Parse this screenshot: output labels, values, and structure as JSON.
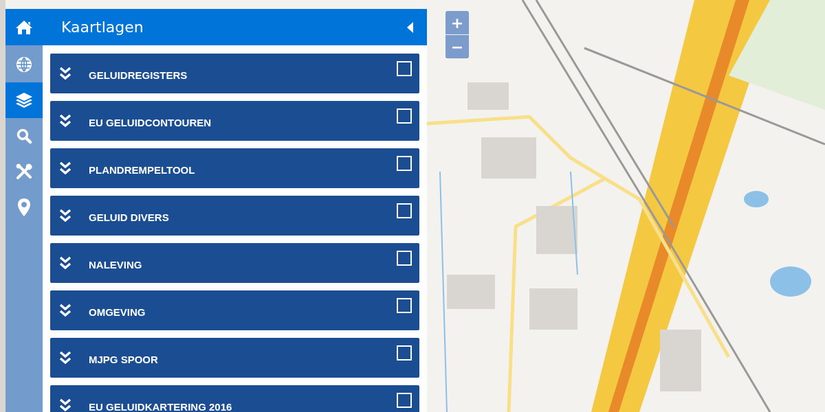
{
  "zoom_controls": [
    "+",
    "−"
  ],
  "panel": {
    "title": "Kaartlagen",
    "nav_items": [
      {
        "kind": "globe",
        "selected": false
      },
      {
        "kind": "layers",
        "selected": true
      },
      {
        "kind": "search",
        "selected": false
      },
      {
        "kind": "tools",
        "selected": false
      },
      {
        "kind": "pin",
        "selected": false
      }
    ],
    "layers": [
      {
        "label": "GELUIDREGISTERS",
        "checked": false,
        "expanded": false
      },
      {
        "label": "EU GELUIDCONTOUREN",
        "checked": false,
        "expanded": false
      },
      {
        "label": "PLANDREMPELTOOL",
        "checked": false,
        "expanded": false
      },
      {
        "label": "GELUID DIVERS",
        "checked": false,
        "expanded": false
      },
      {
        "label": "NALEVING",
        "checked": false,
        "expanded": false
      },
      {
        "label": "OMGEVING",
        "checked": false,
        "expanded": false
      },
      {
        "label": "MJPG SPOOR",
        "checked": false,
        "expanded": false
      },
      {
        "label": "EU GELUIDKARTERING 2016",
        "checked": false,
        "expanded": false
      }
    ]
  }
}
